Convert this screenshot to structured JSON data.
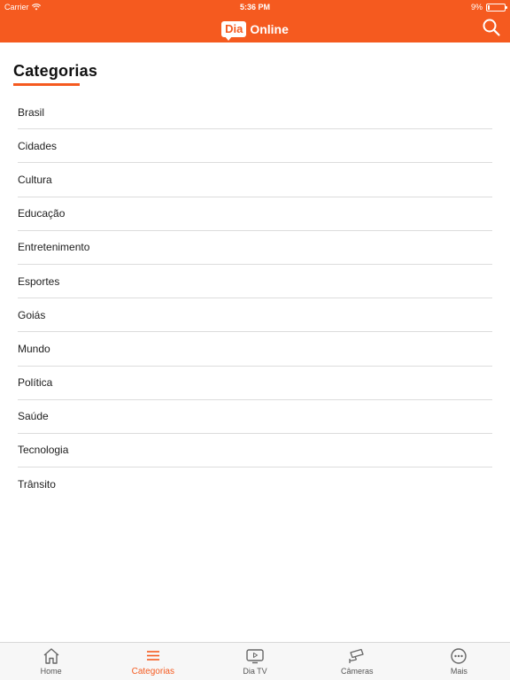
{
  "status_bar": {
    "carrier": "Carrier",
    "time": "5:36 PM",
    "battery": "9%",
    "battery_level": 0.09
  },
  "app_bar": {
    "logo_badge": "Dia",
    "logo_text": "Online",
    "search_icon": "search-icon"
  },
  "page": {
    "title": "Categorias"
  },
  "categories": [
    "Brasil",
    "Cidades",
    "Cultura",
    "Educação",
    "Entretenimento",
    "Esportes",
    "Goiás",
    "Mundo",
    "Política",
    "Saúde",
    "Tecnologia",
    "Trânsito"
  ],
  "tabbar": {
    "tabs": [
      {
        "label": "Home",
        "icon": "home-icon",
        "active": false
      },
      {
        "label": "Categorias",
        "icon": "menu-icon",
        "active": true
      },
      {
        "label": "Dia TV",
        "icon": "tv-icon",
        "active": false
      },
      {
        "label": "Câmeras",
        "icon": "camera-icon",
        "active": false
      },
      {
        "label": "Mais",
        "icon": "more-icon",
        "active": false
      }
    ]
  },
  "colors": {
    "accent": "#f55a1f",
    "tab_inactive": "#555555"
  }
}
